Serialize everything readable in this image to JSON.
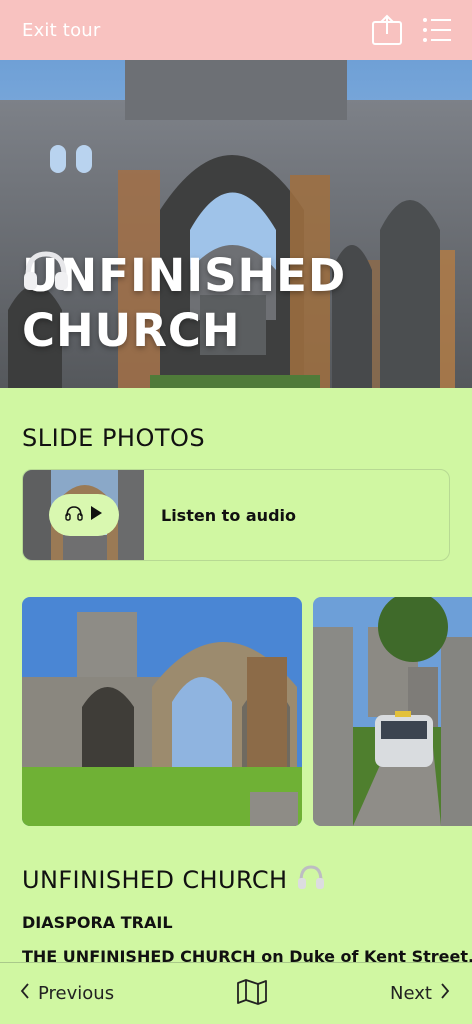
{
  "topbar": {
    "exit_label": "Exit tour",
    "share_icon": "share-icon",
    "menu_icon": "menu-icon"
  },
  "hero": {
    "title_line1": "UNFINISHED",
    "title_line2": "CHURCH",
    "audio_icon": "headphones-icon"
  },
  "slide_photos": {
    "title": "SLIDE PHOTOS",
    "audio_label": "Listen to audio"
  },
  "content": {
    "title": "UNFINISHED CHURCH",
    "subtitle": "DIASPORA TRAIL",
    "text": "THE UNFINISHED CHURCH on Duke of Kent Street,"
  },
  "bottom": {
    "previous_label": "Previous",
    "next_label": "Next",
    "map_icon": "map-icon"
  },
  "colors": {
    "topbar": "#f8c2c0",
    "background": "#d0f7a2",
    "pill": "#d9f8b0"
  }
}
